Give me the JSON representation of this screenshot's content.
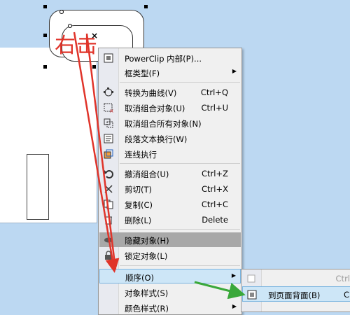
{
  "annotation": {
    "text": "右击",
    "color": "#e0342a"
  },
  "context_menu": {
    "items": [
      {
        "label": "PowerClip 内部(P)...",
        "shortcut": "",
        "icon": "powerclip-icon",
        "submenu": false
      },
      {
        "label": "框类型(F)",
        "shortcut": "",
        "icon": "",
        "submenu": true
      },
      {
        "label": "转换为曲线(V)",
        "shortcut": "Ctrl+Q",
        "icon": "convert-curves-icon",
        "submenu": false
      },
      {
        "label": "取消组合对象(U)",
        "shortcut": "Ctrl+U",
        "icon": "ungroup-icon",
        "submenu": false
      },
      {
        "label": "取消组合所有对象(N)",
        "shortcut": "",
        "icon": "ungroup-all-icon",
        "submenu": false
      },
      {
        "label": "段落文本换行(W)",
        "shortcut": "",
        "icon": "text-wrap-icon",
        "submenu": false
      },
      {
        "label": "连线执行",
        "shortcut": "",
        "icon": "connector-icon",
        "submenu": false
      },
      {
        "label": "撤消组合(U)",
        "shortcut": "Ctrl+Z",
        "icon": "undo-icon",
        "submenu": false
      },
      {
        "label": "剪切(T)",
        "shortcut": "Ctrl+X",
        "icon": "cut-icon",
        "submenu": false
      },
      {
        "label": "复制(C)",
        "shortcut": "Ctrl+C",
        "icon": "copy-icon",
        "submenu": false
      },
      {
        "label": "删除(L)",
        "shortcut": "Delete",
        "icon": "delete-icon",
        "submenu": false
      },
      {
        "label": "隐藏对象(H)",
        "shortcut": "",
        "icon": "hide-icon",
        "submenu": false
      },
      {
        "label": "锁定对象(L)",
        "shortcut": "",
        "icon": "lock-icon",
        "submenu": false
      },
      {
        "label": "顺序(O)",
        "shortcut": "",
        "icon": "",
        "submenu": true
      },
      {
        "label": "对象样式(S)",
        "shortcut": "",
        "icon": "",
        "submenu": true
      },
      {
        "label": "颜色样式(R)",
        "shortcut": "",
        "icon": "",
        "submenu": true
      }
    ]
  },
  "submenu": {
    "items": [
      {
        "label": "",
        "shortcut": "Ctrl",
        "icon": "order-icon"
      },
      {
        "label": "到页面背面(B)",
        "shortcut": "C",
        "icon": "to-back-of-page-icon"
      }
    ]
  },
  "colors": {
    "desktop": "#bcd8f2",
    "highlight_gray": "#a8a8a8",
    "highlight_blue": "#cde6f7",
    "red_arrow": "#e0342a",
    "green_arrow": "#3aa83a"
  }
}
